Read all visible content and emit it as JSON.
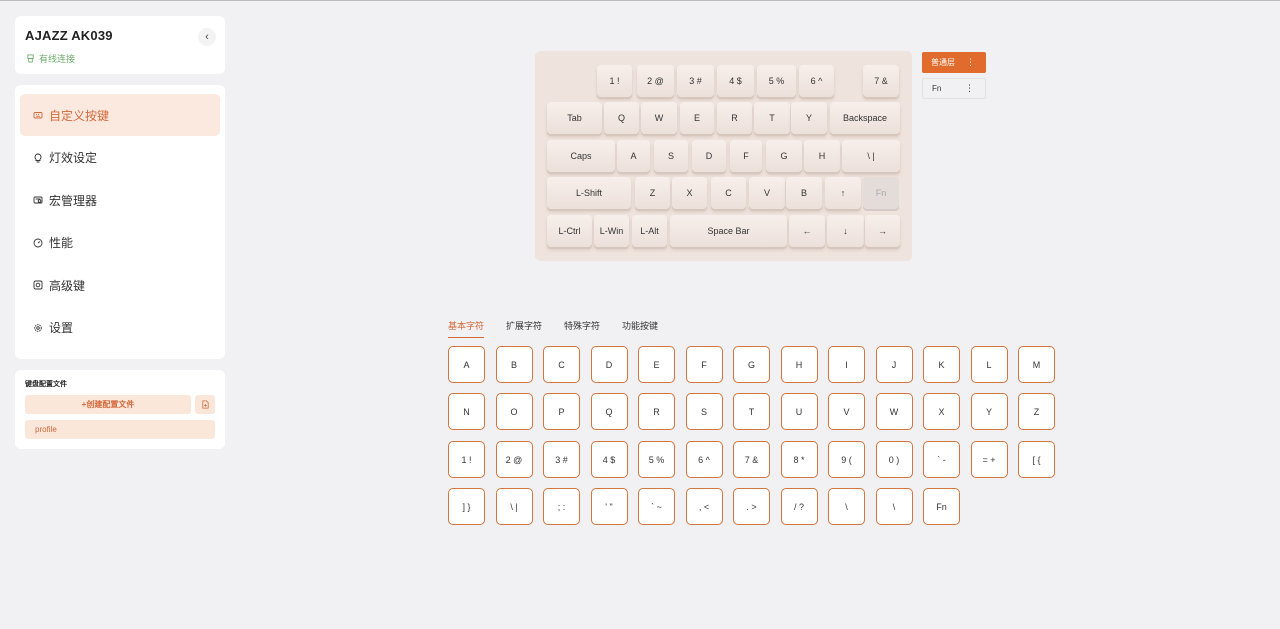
{
  "device": {
    "name": "AJAZZ AK039",
    "connection": "有线连接",
    "collapse_icon": "‹"
  },
  "nav": {
    "items": [
      {
        "label": "自定义按键",
        "icon": "keyboard-icon",
        "active": true
      },
      {
        "label": "灯效设定",
        "icon": "bulb-icon",
        "active": false
      },
      {
        "label": "宏管理器",
        "icon": "macro-icon",
        "active": false
      },
      {
        "label": "性能",
        "icon": "gauge-icon",
        "active": false
      },
      {
        "label": "高级键",
        "icon": "advanced-key-icon",
        "active": false
      },
      {
        "label": "设置",
        "icon": "gear-icon",
        "active": false
      }
    ]
  },
  "profiles": {
    "title": "键盘配置文件",
    "create_label": "+创建配置文件",
    "items": [
      "profile"
    ]
  },
  "keyboard": {
    "rows": [
      [
        "1 !",
        "2 @",
        "3 #",
        "4 $",
        "5 %",
        "6 ^",
        "7 &"
      ],
      [
        "Tab",
        "Q",
        "W",
        "E",
        "R",
        "T",
        "Y",
        "Backspace"
      ],
      [
        "Caps",
        "A",
        "S",
        "D",
        "F",
        "G",
        "H",
        "\\ |"
      ],
      [
        "L-Shift",
        "Z",
        "X",
        "C",
        "V",
        "B",
        "↑",
        "Fn"
      ],
      [
        "L-Ctrl",
        "L-Win",
        "L-Alt",
        "Space Bar",
        "←",
        "↓",
        "→"
      ]
    ]
  },
  "layers": {
    "normal": "普通层",
    "fn": "Fn",
    "menu_icon": "⋮"
  },
  "tabs": [
    "基本字符",
    "扩展字符",
    "特殊字符",
    "功能按键"
  ],
  "active_tab": 0,
  "key_grid": [
    [
      "A",
      "B",
      "C",
      "D",
      "E",
      "F",
      "G",
      "H",
      "I",
      "J",
      "K",
      "L",
      "M"
    ],
    [
      "N",
      "O",
      "P",
      "Q",
      "R",
      "S",
      "T",
      "U",
      "V",
      "W",
      "X",
      "Y",
      "Z"
    ],
    [
      "1 !",
      "2 @",
      "3 #",
      "4 $",
      "5 %",
      "6 ^",
      "7 &",
      "8 *",
      "9 (",
      "0 )",
      "` -",
      "= +",
      "[ {"
    ],
    [
      "] }",
      "\\ |",
      "; :",
      "' \"",
      "` ~",
      ", <",
      ". >",
      "/ ?",
      "\\",
      "\\",
      "Fn"
    ]
  ],
  "colors": {
    "accent": "#e06b2c",
    "accent_light": "#fbe9df",
    "connection": "#6fae6b"
  }
}
